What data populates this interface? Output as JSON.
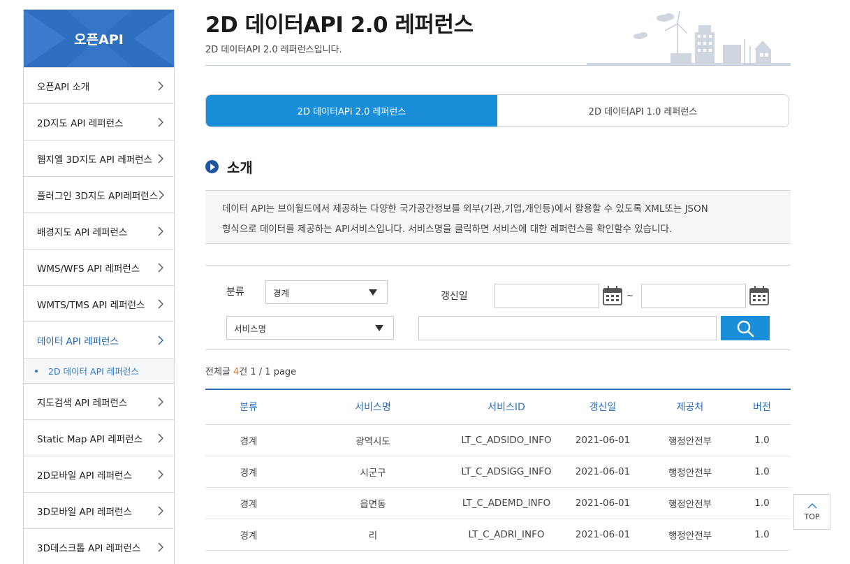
{
  "sidebar": {
    "title": "오픈API",
    "items": [
      {
        "label": "오픈API 소개"
      },
      {
        "label": "2D지도 API 레퍼런스"
      },
      {
        "label": "웹지엘 3D지도 API 레퍼런스"
      },
      {
        "label": "플러그인 3D지도 API레퍼런스"
      },
      {
        "label": "배경지도 API 레퍼런스"
      },
      {
        "label": "WMS/WFS API 레퍼런스"
      },
      {
        "label": "WMTS/TMS API 레퍼런스"
      },
      {
        "label": "데이터 API 레퍼런스"
      },
      {
        "label": "지도검색 API 레퍼런스"
      },
      {
        "label": "Static Map API 레퍼런스"
      },
      {
        "label": "2D모바일 API 레퍼런스"
      },
      {
        "label": "3D모바일 API 레퍼런스"
      },
      {
        "label": "3D데스크톱 API 레퍼런스"
      }
    ],
    "sub_item": "2D 데이터 API 레퍼런스",
    "active_color": "#2163b3"
  },
  "header": {
    "title": "2D 데이터API 2.0 레퍼런스",
    "subtitle": "2D 데이터API 2.0 레퍼런스입니다."
  },
  "tabs": [
    {
      "label": "2D 데이터API 2.0 레퍼런스",
      "selected": true
    },
    {
      "label": "2D 데이터API 1.0 레퍼런스",
      "selected": false
    }
  ],
  "intro": {
    "title": "소개",
    "line1": "데이터 API는 브이월드에서 제공하는 다양한 국가공간정보를 외부(기관,기업,개인등)에서 활용할 수 있도록 XML또는 JSON",
    "line2": "형식으로 데이터를 제공하는 API서비스입니다. 서비스명을 클릭하면 서비스에 대한 레퍼런스를 확인할수 있습니다."
  },
  "search": {
    "category_label": "분류",
    "category_value": "경계",
    "date_label": "갱신일",
    "date_from": "",
    "date_to": "",
    "tilde": "~",
    "field_select": "서비스명",
    "keyword": ""
  },
  "count": {
    "prefix": "전체글 ",
    "total": "4",
    "suffix": "건 1 / 1 page"
  },
  "table": {
    "headers": [
      "분류",
      "서비스명",
      "서비스ID",
      "갱신일",
      "제공처",
      "버전"
    ],
    "rows": [
      [
        "경계",
        "광역시도",
        "LT_C_ADSIDO_INFO",
        "2021-06-01",
        "행정안전부",
        "1.0"
      ],
      [
        "경계",
        "시군구",
        "LT_C_ADSIGG_INFO",
        "2021-06-01",
        "행정안전부",
        "1.0"
      ],
      [
        "경계",
        "읍면동",
        "LT_C_ADEMD_INFO",
        "2021-06-01",
        "행정안전부",
        "1.0"
      ],
      [
        "경계",
        "리",
        "LT_C_ADRI_INFO",
        "2021-06-01",
        "행정안전부",
        "1.0"
      ]
    ]
  },
  "top_button": "TOP",
  "colors": {
    "brand_blue": "#1b8ed9",
    "sidebar_head": "#2f6fbf",
    "count_accent": "#ef6b1a"
  }
}
